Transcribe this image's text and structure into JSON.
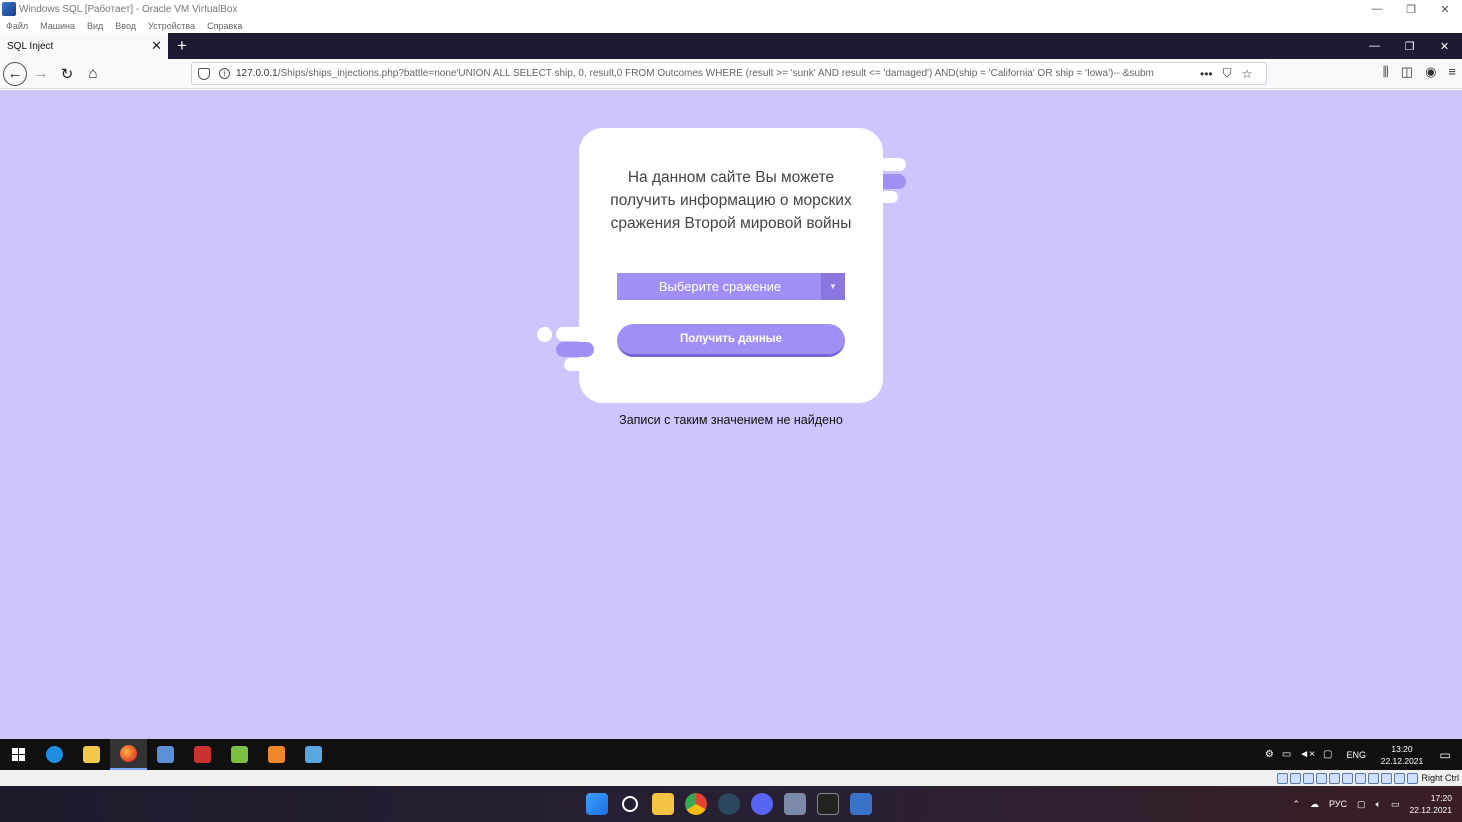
{
  "vbox": {
    "title": "Windows SQL [Работает] - Oracle VM VirtualBox",
    "menu": [
      "Файл",
      "Машина",
      "Вид",
      "Ввод",
      "Устройства",
      "Справка"
    ],
    "status_text": "Right Ctrl"
  },
  "browser": {
    "tab_title": "SQL Inject",
    "url_host": "127.0.0.1",
    "url_rest": "/Ships/ships_injections.php?battle=none'UNION ALL SELECT ship, 0, result,0 FROM Outcomes WHERE (result >= 'sunk' AND result <= 'damaged') AND(ship = 'California' OR ship = 'Iowa')-- &subm"
  },
  "page": {
    "description": "На данном сайте Вы можете получить информацию о морских сражения Второй мировой войны",
    "select_placeholder": "Выберите сражение",
    "submit_label": "Получить данные",
    "result_message": "Записи с таким значением не найдено",
    "colors": {
      "background": "#cfc4fb",
      "accent": "#a28ff5"
    }
  },
  "guest_taskbar": {
    "lang": "ENG",
    "time": "13:20",
    "date": "22.12.2021"
  },
  "host_taskbar": {
    "lang": "РУС",
    "time": "17:20",
    "date": "22.12.2021"
  }
}
